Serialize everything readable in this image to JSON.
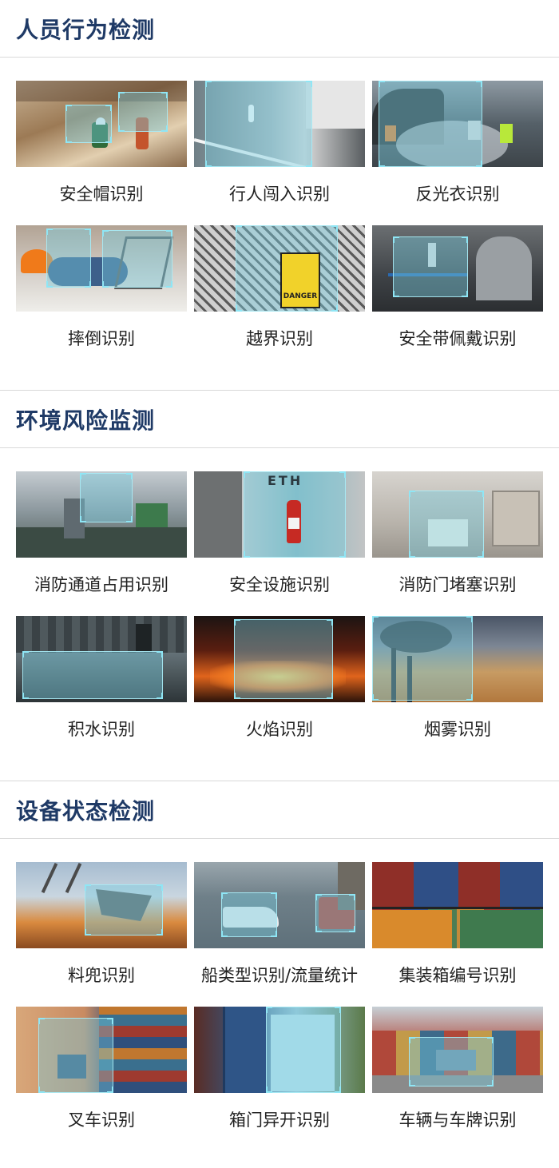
{
  "sections": [
    {
      "title": "人员行为检测",
      "items": [
        "安全帽识别",
        "行人闯入识别",
        "反光衣识别",
        "摔倒识别",
        "越界识别",
        "安全带佩戴识别"
      ]
    },
    {
      "title": "环境风险监测",
      "items": [
        "消防通道占用识别",
        "安全设施识别",
        "消防门堵塞识别",
        "积水识别",
        "火焰识别",
        "烟雾识别"
      ]
    },
    {
      "title": "设备状态检测",
      "items": [
        "料兜识别",
        "船类型识别/流量统计",
        "集装箱编号识别",
        "叉车识别",
        "箱门异开识别",
        "车辆与车牌识别"
      ]
    }
  ],
  "thumbnail_text": {
    "danger_sign": "DANGER",
    "wall_letters": "ETH"
  },
  "colors": {
    "section_title": "#1f3a66",
    "divider": "#d9d9d9",
    "detection_overlay": "#78cde1"
  }
}
